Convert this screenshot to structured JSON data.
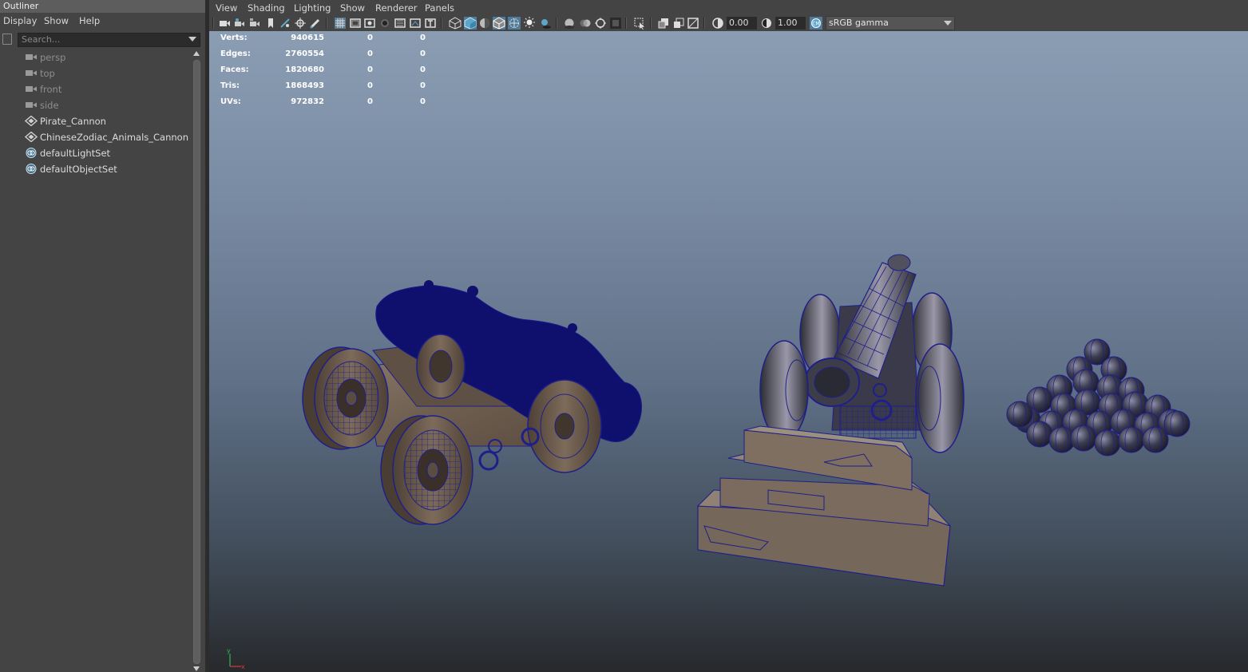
{
  "outliner": {
    "title": "Outliner",
    "menu": [
      "Display",
      "Show",
      "Help"
    ],
    "search_placeholder": "Search...",
    "items": [
      {
        "label": "persp",
        "icon": "camera-icon",
        "dim": true
      },
      {
        "label": "top",
        "icon": "camera-icon",
        "dim": true
      },
      {
        "label": "front",
        "icon": "camera-icon",
        "dim": true
      },
      {
        "label": "side",
        "icon": "camera-icon",
        "dim": true
      },
      {
        "label": "Pirate_Cannon",
        "icon": "transform-group-icon",
        "dim": false
      },
      {
        "label": "ChineseZodiac_Animals_Cannon",
        "icon": "transform-group-icon",
        "dim": false
      },
      {
        "label": "defaultLightSet",
        "icon": "object-set-icon",
        "dim": false
      },
      {
        "label": "defaultObjectSet",
        "icon": "object-set-icon",
        "dim": false
      }
    ]
  },
  "viewport": {
    "menu": [
      "View",
      "Shading",
      "Lighting",
      "Show",
      "Renderer",
      "Panels"
    ],
    "toolbar": {
      "exposure": "0.00",
      "gamma": "1.00",
      "color_space": "sRGB gamma",
      "accent_color": "#5da6c9"
    },
    "hud": [
      {
        "label": "Verts:",
        "v1": "940615",
        "v2": "0",
        "v3": "0"
      },
      {
        "label": "Edges:",
        "v1": "2760554",
        "v2": "0",
        "v3": "0"
      },
      {
        "label": "Faces:",
        "v1": "1820680",
        "v2": "0",
        "v3": "0"
      },
      {
        "label": "Tris:",
        "v1": "1868493",
        "v2": "0",
        "v3": "0"
      },
      {
        "label": "UVs:",
        "v1": "972832",
        "v2": "0",
        "v3": "0"
      }
    ],
    "axis": {
      "y": "y",
      "x": "x"
    },
    "wire_color": "#1f1f8a"
  }
}
